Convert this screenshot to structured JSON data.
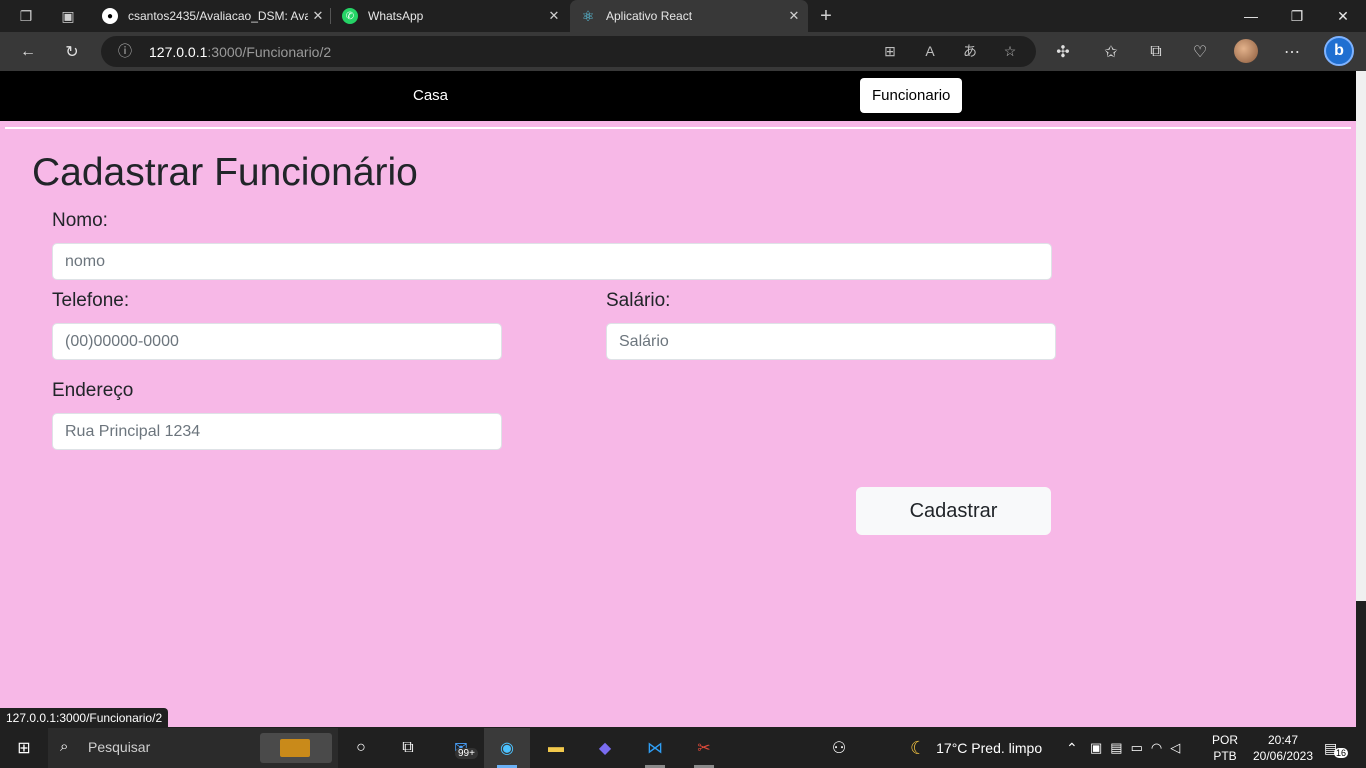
{
  "browser": {
    "tabs": [
      {
        "title": "csantos2435/Avaliacao_DSM: Ava",
        "favicon": "github-icon",
        "active": false
      },
      {
        "title": "WhatsApp",
        "favicon": "whatsapp-icon",
        "active": false
      },
      {
        "title": "Aplicativo React",
        "favicon": "react-icon",
        "active": true
      }
    ],
    "new_tab_label": "+",
    "url_host": "127.0.0.1",
    "url_path": ":3000/Funcionario/2"
  },
  "app": {
    "nav": {
      "home": "Casa",
      "employee": "Funcionario"
    },
    "title": "Cadastrar Funcionário",
    "form": {
      "name_label": "Nomo:",
      "name_placeholder": "nomo",
      "phone_label": "Telefone:",
      "phone_placeholder": "(00)00000-0000",
      "salary_label": "Salário:",
      "salary_placeholder": "Salário",
      "address_label": "Endereço",
      "address_placeholder": "Rua Principal 1234",
      "submit_label": "Cadastrar"
    }
  },
  "status_url": "127.0.0.1:3000/Funcionario/2",
  "taskbar": {
    "search_placeholder": "Pesquisar",
    "mail_badge": "99+",
    "weather": "17°C  Pred. limpo",
    "lang_top": "POR",
    "lang_bottom": "PTB",
    "time": "20:47",
    "date": "20/06/2023",
    "notifications": "16"
  },
  "colors": {
    "page_bg": "#f7b8e7",
    "nav_bg": "#000000"
  }
}
